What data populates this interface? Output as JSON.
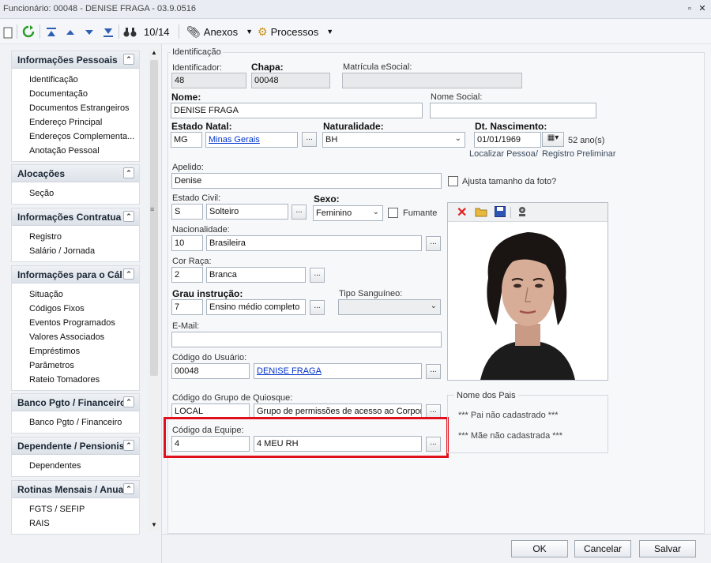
{
  "window": {
    "title": "Funcionário: 00048 - DENISE FRAGA - 03.9.0516",
    "pin_icon": "pin-icon",
    "close_icon": "close-icon"
  },
  "toolbar": {
    "record_counter": "10/14",
    "anexos_label": "Anexos",
    "processos_label": "Processos"
  },
  "sidebar": {
    "groups": [
      {
        "title": "Informações Pessoais",
        "items": [
          "Identificação",
          "Documentação",
          "Documentos Estrangeiros",
          "Endereço Principal",
          "Endereços Complementa...",
          "Anotação Pessoal"
        ]
      },
      {
        "title": "Alocações",
        "items": [
          "Seção"
        ]
      },
      {
        "title": "Informações Contratua",
        "items": [
          "Registro",
          "Salário / Jornada"
        ]
      },
      {
        "title": "Informações para o Cál",
        "items": [
          "Situação",
          "Códigos Fixos",
          "Eventos Programados",
          "Valores Associados",
          "Empréstimos",
          "Parâmetros",
          "Rateio Tomadores"
        ]
      },
      {
        "title": "Banco Pgto / Financeiro",
        "items": [
          "Banco Pgto / Financeiro"
        ]
      },
      {
        "title": "Dependente / Pensionis",
        "items": [
          "Dependentes"
        ]
      },
      {
        "title": "Rotinas Mensais / Anua",
        "items": [
          "FGTS / SEFIP",
          "RAIS"
        ]
      }
    ]
  },
  "form": {
    "section_title": "Identificação",
    "identificador": {
      "label": "Identificador:",
      "value": "48"
    },
    "chapa": {
      "label": "Chapa:",
      "value": "00048"
    },
    "matricula_esocial": {
      "label": "Matrícula eSocial:",
      "value": ""
    },
    "nome": {
      "label": "Nome:",
      "value": "DENISE FRAGA"
    },
    "nome_social": {
      "label": "Nome Social:",
      "value": ""
    },
    "estado_natal": {
      "label": "Estado Natal:",
      "code": "MG",
      "name": "Minas Gerais"
    },
    "naturalidade": {
      "label": "Naturalidade:",
      "value": "BH"
    },
    "dt_nascimento": {
      "label": "Dt. Nascimento:",
      "value": "01/01/1969",
      "age": "52 ano(s)"
    },
    "links": {
      "localizar": "Localizar Pessoa",
      "sep": "/",
      "registro": "Registro Preliminar"
    },
    "apelido": {
      "label": "Apelido:",
      "value": "Denise"
    },
    "ajusta_foto": {
      "label": "Ajusta tamanho da foto?"
    },
    "estado_civil": {
      "label": "Estado Civil:",
      "code": "S",
      "name": "Solteiro"
    },
    "sexo": {
      "label": "Sexo:",
      "value": "Feminino"
    },
    "fumante": {
      "label": "Fumante"
    },
    "nacionalidade": {
      "label": "Nacionalidade:",
      "code": "10",
      "name": "Brasileira"
    },
    "cor_raca": {
      "label": "Cor Raça:",
      "code": "2",
      "name": "Branca"
    },
    "grau_instrucao": {
      "label": "Grau instrução:",
      "code": "7",
      "name": "Ensino médio completo"
    },
    "tipo_sanguineo": {
      "label": "Tipo Sanguíneo:",
      "value": ""
    },
    "email": {
      "label": "E-Mail:",
      "value": ""
    },
    "codigo_usuario": {
      "label": "Código do Usuário:",
      "code": "00048",
      "name": "DENISE FRAGA"
    },
    "grupo_quiosque": {
      "label": "Código do Grupo de Quiosque:",
      "code": "LOCAL",
      "name": "Grupo de permissões de acesso ao Corporel"
    },
    "codigo_equipe": {
      "label": "Código da Equipe:",
      "code": "4",
      "name": "4 MEU RH"
    },
    "nome_pais": {
      "title": "Nome dos Pais",
      "pai": "*** Pai não cadastrado ***",
      "mae": "*** Mãe não cadastrada ***"
    },
    "dots_label": "..."
  },
  "footer": {
    "ok": "OK",
    "cancelar": "Cancelar",
    "salvar": "Salvar"
  },
  "colors": {
    "highlight": "#e0101c",
    "link": "#0033cc"
  }
}
